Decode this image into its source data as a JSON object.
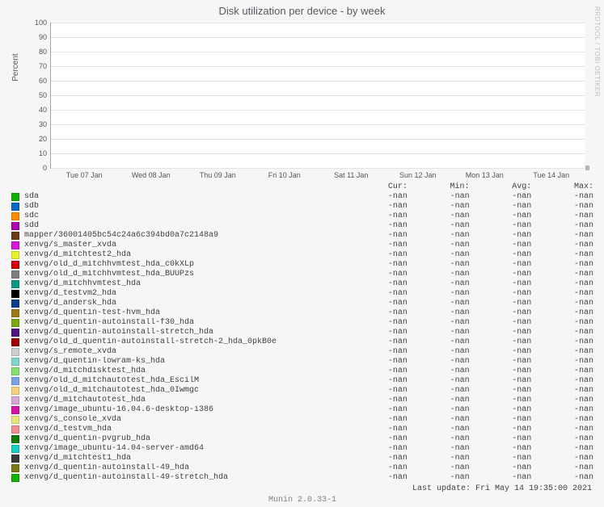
{
  "title": "Disk utilization per device - by week",
  "watermark": "RRDTOOL / TOBI OETIKER",
  "ylabel": "Percent",
  "footer": "Munin 2.0.33-1",
  "last_update": "Last update: Fri May 14 19:35:00 2021",
  "chart_data": {
    "type": "line",
    "title": "Disk utilization per device - by week",
    "ylabel": "Percent",
    "xlabel": "",
    "ylim": [
      0,
      100
    ],
    "yticks": [
      0,
      10,
      20,
      30,
      40,
      50,
      60,
      70,
      80,
      90,
      100
    ],
    "xticks": [
      "Tue 07 Jan",
      "Wed 08 Jan",
      "Thu 09 Jan",
      "Fri 10 Jan",
      "Sat 11 Jan",
      "Sun 12 Jan",
      "Mon 13 Jan",
      "Tue 14 Jan"
    ],
    "stat_columns": [
      "Cur:",
      "Min:",
      "Avg:",
      "Max:"
    ],
    "series": [
      {
        "name": "sda",
        "color": "#12b000",
        "cur": "-nan",
        "min": "-nan",
        "avg": "-nan",
        "max": "-nan"
      },
      {
        "name": "sdb",
        "color": "#0d67c8",
        "cur": "-nan",
        "min": "-nan",
        "avg": "-nan",
        "max": "-nan"
      },
      {
        "name": "sdc",
        "color": "#ff8c00",
        "cur": "-nan",
        "min": "-nan",
        "avg": "-nan",
        "max": "-nan"
      },
      {
        "name": "sdd",
        "color": "#b000b0",
        "cur": "-nan",
        "min": "-nan",
        "avg": "-nan",
        "max": "-nan"
      },
      {
        "name": "mapper/36001405bc54c24a6c394bd0a7c2148a9",
        "color": "#6b3a1a",
        "cur": "-nan",
        "min": "-nan",
        "avg": "-nan",
        "max": "-nan"
      },
      {
        "name": "xenvg/s_master_xvda",
        "color": "#d915d9",
        "cur": "-nan",
        "min": "-nan",
        "avg": "-nan",
        "max": "-nan"
      },
      {
        "name": "xenvg/d_mitchtest2_hda",
        "color": "#e7f22a",
        "cur": "-nan",
        "min": "-nan",
        "avg": "-nan",
        "max": "-nan"
      },
      {
        "name": "xenvg/old_d_mitchhvmtest_hda_c0kXLp",
        "color": "#d40000",
        "cur": "-nan",
        "min": "-nan",
        "avg": "-nan",
        "max": "-nan"
      },
      {
        "name": "xenvg/old_d_mitchhvmtest_hda_BUUPzs",
        "color": "#7f7f7f",
        "cur": "-nan",
        "min": "-nan",
        "avg": "-nan",
        "max": "-nan"
      },
      {
        "name": "xenvg/d_mitchhvmtest_hda",
        "color": "#0a9b87",
        "cur": "-nan",
        "min": "-nan",
        "avg": "-nan",
        "max": "-nan"
      },
      {
        "name": "xenvg/d_testvm2_hda",
        "color": "#000000",
        "cur": "-nan",
        "min": "-nan",
        "avg": "-nan",
        "max": "-nan"
      },
      {
        "name": "xenvg/d_andersk_hda",
        "color": "#0a3f8e",
        "cur": "-nan",
        "min": "-nan",
        "avg": "-nan",
        "max": "-nan"
      },
      {
        "name": "xenvg/d_quentin-test-hvm_hda",
        "color": "#9a7a14",
        "cur": "-nan",
        "min": "-nan",
        "avg": "-nan",
        "max": "-nan"
      },
      {
        "name": "xenvg/d_quentin-autoinstall-f30_hda",
        "color": "#7aa80f",
        "cur": "-nan",
        "min": "-nan",
        "avg": "-nan",
        "max": "-nan"
      },
      {
        "name": "xenvg/d_quentin-autoinstall-stretch_hda",
        "color": "#4f1480",
        "cur": "-nan",
        "min": "-nan",
        "avg": "-nan",
        "max": "-nan"
      },
      {
        "name": "xenvg/old_d_quentin-autoinstall-stretch-2_hda_0pkB0e",
        "color": "#a00000",
        "cur": "-nan",
        "min": "-nan",
        "avg": "-nan",
        "max": "-nan"
      },
      {
        "name": "xenvg/s_remote_xvda",
        "color": "#cdcdcd",
        "cur": "-nan",
        "min": "-nan",
        "avg": "-nan",
        "max": "-nan"
      },
      {
        "name": "xenvg/d_quentin-lowram-ks_hda",
        "color": "#80d6cc",
        "cur": "-nan",
        "min": "-nan",
        "avg": "-nan",
        "max": "-nan"
      },
      {
        "name": "xenvg/d_mitchdisktest_hda",
        "color": "#83e070",
        "cur": "-nan",
        "min": "-nan",
        "avg": "-nan",
        "max": "-nan"
      },
      {
        "name": "xenvg/old_d_mitchautotest_hda_EscilM",
        "color": "#7aa2e8",
        "cur": "-nan",
        "min": "-nan",
        "avg": "-nan",
        "max": "-nan"
      },
      {
        "name": "xenvg/old_d_mitchautotest_hda_0Iwmgc",
        "color": "#f5cf7a",
        "cur": "-nan",
        "min": "-nan",
        "avg": "-nan",
        "max": "-nan"
      },
      {
        "name": "xenvg/d_mitchautotest_hda",
        "color": "#d9a6d9",
        "cur": "-nan",
        "min": "-nan",
        "avg": "-nan",
        "max": "-nan"
      },
      {
        "name": "xenvg/image_ubuntu-16.04.6-desktop-i386",
        "color": "#d615a8",
        "cur": "-nan",
        "min": "-nan",
        "avg": "-nan",
        "max": "-nan"
      },
      {
        "name": "xenvg/s_console_xvda",
        "color": "#e6e67a",
        "cur": "-nan",
        "min": "-nan",
        "avg": "-nan",
        "max": "-nan"
      },
      {
        "name": "xenvg/d_testvm_hda",
        "color": "#ef8f8f",
        "cur": "-nan",
        "min": "-nan",
        "avg": "-nan",
        "max": "-nan"
      },
      {
        "name": "xenvg/d_quentin-pvgrub_hda",
        "color": "#0a7a0a",
        "cur": "-nan",
        "min": "-nan",
        "avg": "-nan",
        "max": "-nan"
      },
      {
        "name": "xenvg/image_ubuntu-14.04-server-amd64",
        "color": "#17d0c4",
        "cur": "-nan",
        "min": "-nan",
        "avg": "-nan",
        "max": "-nan"
      },
      {
        "name": "xenvg/d_mitchtest1_hda",
        "color": "#3a3a3a",
        "cur": "-nan",
        "min": "-nan",
        "avg": "-nan",
        "max": "-nan"
      },
      {
        "name": "xenvg/d_quentin-autoinstall-49_hda",
        "color": "#7a7a14",
        "cur": "-nan",
        "min": "-nan",
        "avg": "-nan",
        "max": "-nan"
      },
      {
        "name": "xenvg/d_quentin-autoinstall-49-stretch_hda",
        "color": "#12b000",
        "cur": "-nan",
        "min": "-nan",
        "avg": "-nan",
        "max": "-nan"
      }
    ]
  }
}
